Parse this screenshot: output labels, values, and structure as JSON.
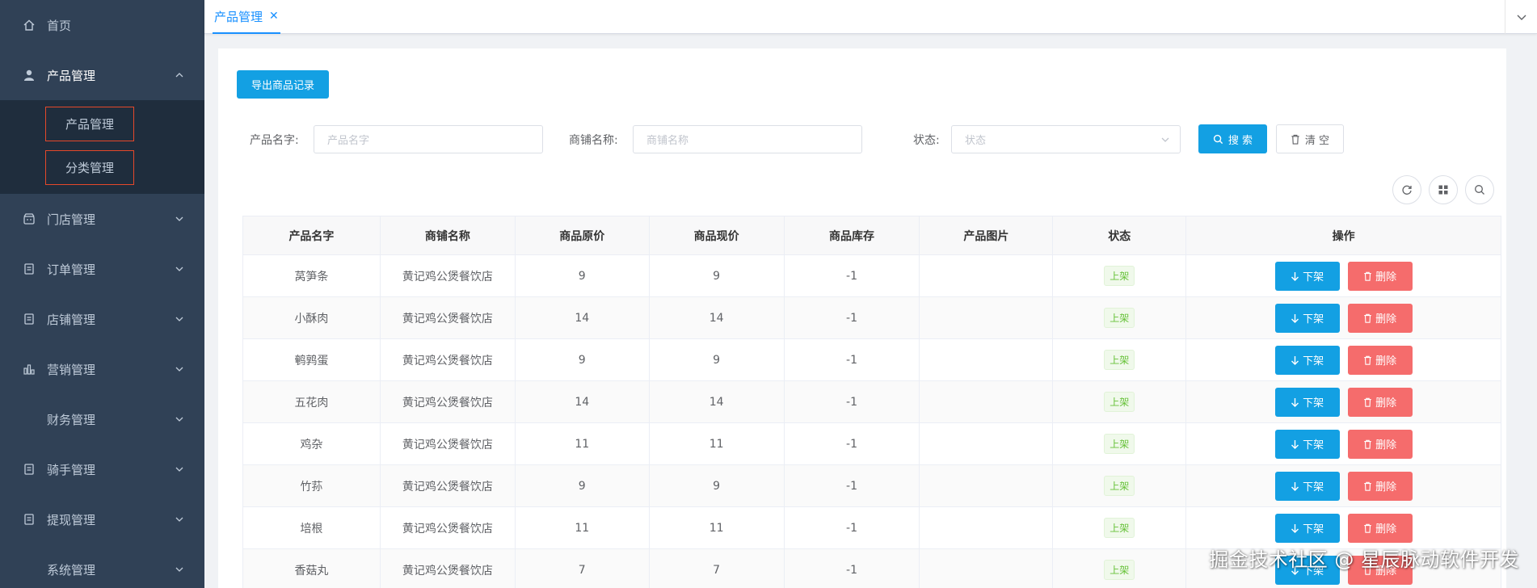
{
  "sidebar": {
    "items": [
      {
        "label": "首页",
        "icon": "home-icon"
      },
      {
        "label": "产品管理",
        "icon": "user-icon",
        "open": true,
        "children": [
          {
            "label": "产品管理"
          },
          {
            "label": "分类管理"
          }
        ]
      },
      {
        "label": "门店管理",
        "icon": "store-icon"
      },
      {
        "label": "订单管理",
        "icon": "document-icon"
      },
      {
        "label": "店铺管理",
        "icon": "document-icon"
      },
      {
        "label": "营销管理",
        "icon": "chart-bars-icon"
      },
      {
        "label": "财务管理",
        "icon": ""
      },
      {
        "label": "骑手管理",
        "icon": "document-icon"
      },
      {
        "label": "提现管理",
        "icon": "document-icon"
      },
      {
        "label": "系统管理",
        "icon": ""
      }
    ]
  },
  "tags": {
    "active": "产品管理",
    "close": "✕"
  },
  "toolbar": {
    "export_label": "导出商品记录"
  },
  "search": {
    "name_label": "产品名字:",
    "name_placeholder": "产品名字",
    "shop_label": "商铺名称:",
    "shop_placeholder": "商铺名称",
    "status_label": "状态:",
    "status_placeholder": "状态",
    "search_label": "搜 索",
    "clear_label": "清 空"
  },
  "table": {
    "headers": [
      "产品名字",
      "商铺名称",
      "商品原价",
      "商品现价",
      "商品库存",
      "产品图片",
      "状态",
      "操作"
    ],
    "rows": [
      {
        "name": "莴笋条",
        "shop": "黄记鸡公煲餐饮店",
        "orig": "9",
        "now": "9",
        "stock": "-1",
        "status": "上架"
      },
      {
        "name": "小酥肉",
        "shop": "黄记鸡公煲餐饮店",
        "orig": "14",
        "now": "14",
        "stock": "-1",
        "status": "上架"
      },
      {
        "name": "鹌鹑蛋",
        "shop": "黄记鸡公煲餐饮店",
        "orig": "9",
        "now": "9",
        "stock": "-1",
        "status": "上架"
      },
      {
        "name": "五花肉",
        "shop": "黄记鸡公煲餐饮店",
        "orig": "14",
        "now": "14",
        "stock": "-1",
        "status": "上架"
      },
      {
        "name": "鸡杂",
        "shop": "黄记鸡公煲餐饮店",
        "orig": "11",
        "now": "11",
        "stock": "-1",
        "status": "上架"
      },
      {
        "name": "竹荪",
        "shop": "黄记鸡公煲餐饮店",
        "orig": "9",
        "now": "9",
        "stock": "-1",
        "status": "上架"
      },
      {
        "name": "培根",
        "shop": "黄记鸡公煲餐饮店",
        "orig": "11",
        "now": "11",
        "stock": "-1",
        "status": "上架"
      },
      {
        "name": "香菇丸",
        "shop": "黄记鸡公煲餐饮店",
        "orig": "7",
        "now": "7",
        "stock": "-1",
        "status": "上架"
      }
    ],
    "down_label": "下架",
    "delete_label": "删除"
  },
  "watermark": "掘金技术社区 @ 星辰脉动软件开发"
}
